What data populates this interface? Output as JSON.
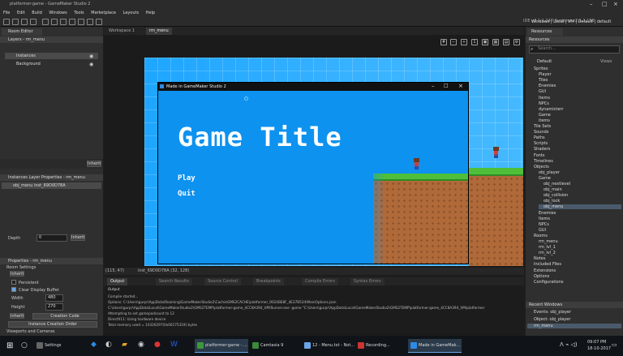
{
  "window": {
    "title": "platformer-game - GameMaker Studio 2"
  },
  "menu": [
    "File",
    "Edit",
    "Build",
    "Windows",
    "Tools",
    "Marketplace",
    "Layouts",
    "Help"
  ],
  "ide_version": "IDE v2.1.1.247 Runtime v2.1.1.158",
  "target_bar": "Windows | Local | VM | Default | default",
  "left": {
    "tab": "Room Editor",
    "layers_title": "Layers - rm_menu",
    "layers": [
      "Instances",
      "Background"
    ],
    "inherit": "Inherit",
    "instances_title": "Instances Layer Properties - rm_menu",
    "instance_row": "obj_menu    inst_69D0D78A",
    "depth_label": "Depth",
    "depth_value": "0",
    "properties_title": "Properties - rm_menu",
    "room_settings": "Room Settings",
    "persistent": "Persistent",
    "clear_display": "Clear Display Buffer",
    "width_label": "Width",
    "width_value": "480",
    "height_label": "Height",
    "height_value": "270",
    "creation_code": "Creation Code",
    "instance_creation_order": "Instance Creation Order",
    "viewports": "Viewports and Cameras"
  },
  "room_tabs": [
    "Workspace 1",
    "rm_menu"
  ],
  "game_window": {
    "title": "Made in GameMaker Studio 2",
    "game_title": "Game Title",
    "menu": [
      "Play",
      "Quit"
    ]
  },
  "status": {
    "mouse": "(115, 47)",
    "instance": "inst_69D0D78A  (32, 128)"
  },
  "output_tabs": [
    "Output",
    "Search Results",
    "Source Control",
    "Breakpoints",
    "Compile Errors",
    "Syntax Errors"
  ],
  "output_lines": [
    "Output",
    "Compile started...",
    "Options: C:\\Users\\gurpr\\AppData\\Roaming\\GameMakerStudio2\\Cache\\GMS2CACHE\\platformer_9024BE8F_4E37B534\\MainOptions.json",
    "C:\\Users\\gurpr\\AppData\\Local\\GameMakerStudio2\\GMS2TEMP\\platformer-game_4CC8A394_VM\\Runner.exe  -game \"C:\\Users\\gurpr\\AppData\\Local\\GameMakerStudio2\\GMS2TEMP\\platformer-game_4CC8A394_VM\\platformer",
    "Attempting to set gamepadcount to 12",
    "DirectX11: Using hardware device",
    "Total memory used = 10326297(0x00175319) bytes"
  ],
  "resources": {
    "title": "Resources",
    "subtitle": "Resources",
    "search_placeholder": "Search...",
    "default_label": "Default",
    "views_label": "Views",
    "tree": [
      {
        "label": "Sprites",
        "indent": 0
      },
      {
        "label": "Player",
        "indent": 1
      },
      {
        "label": "Tiles",
        "indent": 1
      },
      {
        "label": "Enemies",
        "indent": 1
      },
      {
        "label": "GUI",
        "indent": 1
      },
      {
        "label": "Items",
        "indent": 1
      },
      {
        "label": "NPCs",
        "indent": 1
      },
      {
        "label": "dynamicterr",
        "indent": 1
      },
      {
        "label": "Game",
        "indent": 1
      },
      {
        "label": "items",
        "indent": 1
      },
      {
        "label": "Tile Sets",
        "indent": 0
      },
      {
        "label": "Sounds",
        "indent": 0
      },
      {
        "label": "Paths",
        "indent": 0
      },
      {
        "label": "Scripts",
        "indent": 0
      },
      {
        "label": "Shaders",
        "indent": 0
      },
      {
        "label": "Fonts",
        "indent": 0
      },
      {
        "label": "Timelines",
        "indent": 0
      },
      {
        "label": "Objects",
        "indent": 0
      },
      {
        "label": "obj_player",
        "indent": 1
      },
      {
        "label": "Game",
        "indent": 1
      },
      {
        "label": "obj_nextlevel",
        "indent": 2
      },
      {
        "label": "obj_main",
        "indent": 2
      },
      {
        "label": "obj_collision",
        "indent": 2
      },
      {
        "label": "obj_lock",
        "indent": 2
      },
      {
        "label": "obj_menu",
        "indent": 2
      },
      {
        "label": "Enemies",
        "indent": 1
      },
      {
        "label": "Items",
        "indent": 1
      },
      {
        "label": "NPCs",
        "indent": 1
      },
      {
        "label": "GUI",
        "indent": 1
      },
      {
        "label": "Rooms",
        "indent": 0
      },
      {
        "label": "rm_menu",
        "indent": 1
      },
      {
        "label": "rm_lvl_1",
        "indent": 1
      },
      {
        "label": "rm_lvl_2",
        "indent": 1
      },
      {
        "label": "Notes",
        "indent": 0
      },
      {
        "label": "Included Files",
        "indent": 0
      },
      {
        "label": "Extensions",
        "indent": 0
      },
      {
        "label": "Options",
        "indent": 0
      },
      {
        "label": "Configurations",
        "indent": 0
      }
    ],
    "recent_title": "Recent Windows",
    "recent": [
      "Events: obj_player",
      "Object: obj_player",
      "rm_menu"
    ]
  },
  "taskbar": {
    "items": [
      "Settings",
      "platformer-game - ...",
      "Camtasia 9",
      "12 - Menu.txt - Not...",
      "Recording...",
      "Made in GameMak..."
    ],
    "time": "09:07 PM",
    "date": "18-10-2017"
  }
}
